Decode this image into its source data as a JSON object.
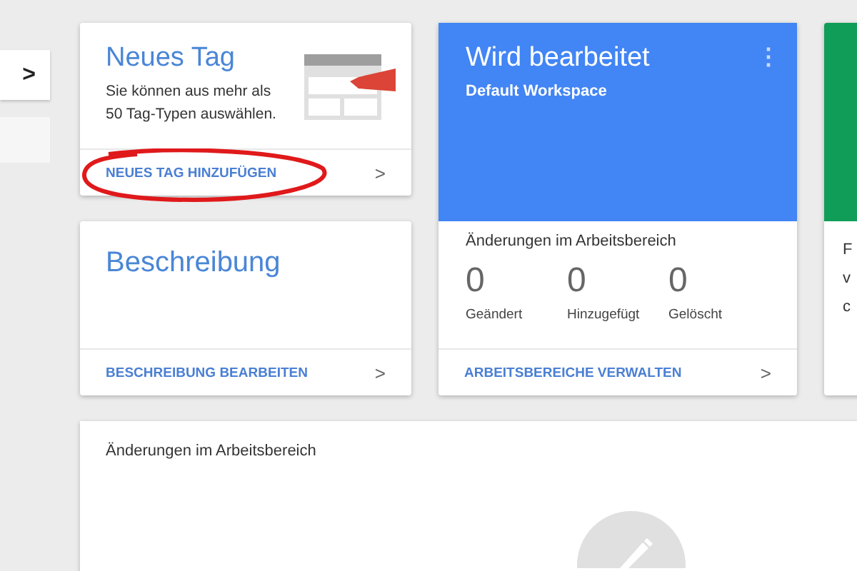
{
  "sidebar": {
    "expand_button": ">"
  },
  "new_tag_card": {
    "title": "Neues Tag",
    "description": "Sie können aus mehr als 50 Tag-Typen auswählen.",
    "link": "NEUES TAG HINZUFÜGEN",
    "chevron": ">"
  },
  "description_card": {
    "title": "Beschreibung",
    "link": "BESCHREIBUNG BEARBEITEN",
    "chevron": ">"
  },
  "workspace_card": {
    "title": "Wird bearbeitet",
    "subtitle": "Default Workspace",
    "menu": "⋮",
    "changes_title": "Änderungen im Arbeitsbereich",
    "stats": [
      {
        "value": "0",
        "label": "Geändert"
      },
      {
        "value": "0",
        "label": "Hinzugefügt"
      },
      {
        "value": "0",
        "label": "Gelöscht"
      }
    ],
    "link": "ARBEITSBEREICHE VERWALTEN",
    "chevron": ">"
  },
  "version_card": {
    "lines": [
      "F",
      "v",
      "c"
    ]
  },
  "changes_panel": {
    "title": "Änderungen im Arbeitsbereich"
  }
}
